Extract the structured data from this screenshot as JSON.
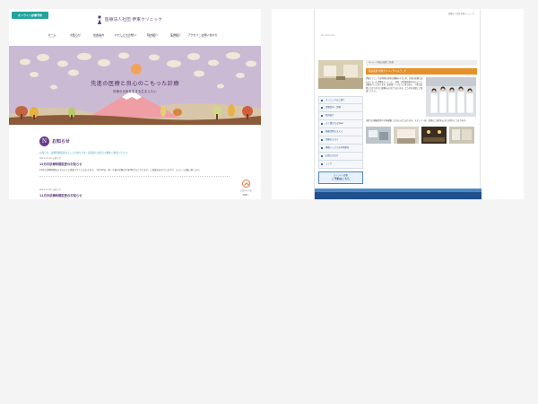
{
  "left": {
    "online_button": "オンライン診療予約",
    "logo_text": "医療法人社団 伊東クリニック",
    "nav": [
      {
        "label": "ホーム",
        "en": "HOME"
      },
      {
        "label": "お知らせ",
        "en": "NEWS"
      },
      {
        "label": "診療案内",
        "en": "MEDICAL"
      },
      {
        "label": "わたしたちの想い",
        "en": "MESSAGE"
      },
      {
        "label": "院内紹介",
        "en": "FACILITY"
      },
      {
        "label": "医師紹介",
        "en": "DOCTOR"
      },
      {
        "label": "アクセス・お問い合わせ",
        "en": "ACCESS"
      }
    ],
    "hero_title": "先進の医療と良心のこもった診療",
    "hero_subtitle": "診療の元気を生きる生まえたい",
    "news_badge": "N",
    "news_title": "お知らせ",
    "news_notice": "お知らせ、診療時間変更なることがあります。来院前にお知らせ欄をご確認ください。",
    "news": [
      {
        "date": "2021.12.22  お知らせ",
        "title": "12月の診療時間変更のお知らせ",
        "body": "12月の診療時間を以下のように変更させていただきます。 12月30日（木）午後の診療は午後3時からとなります。ご迷惑をおかけしますが、よろしくお願い致します。"
      },
      {
        "date": "2021.11.25  お知らせ",
        "title": "11月の診療時間変更のお知らせ",
        "body": ""
      }
    ],
    "totop_line1": "このページの",
    "totop_line2": "TOPへ"
  },
  "right": {
    "top_right": "医療法人社団 伊東クリニック",
    "site_name": "ito-clinic.com",
    "menu": [
      "クリニックのご紹介",
      "診療案内・診療",
      "院内紹介",
      "よく聞かれるQ&A",
      "健康診断のススメ",
      "診療のススメ",
      "睡眠ドックでも早期発見",
      "お問い合わせ",
      "リンク"
    ],
    "banner_line1": "オンライン診療",
    "banner_line2": "ご予約はこちら",
    "breadcrumb": "ホーム > 院長の挨拶 ご挨拶",
    "heading": "院長挨拶 伊東クリニックへようこそ",
    "text": "伊東クリニックは地域の皆様の健康を守るため、先進の医療と良心のこもった診療をモットーに、内科・消化器内科を中心とした診療を行っております。患者様一人ひとりに寄り添い、丁寧な説明とわかりやすい医療を心がけております。どうぞお気軽にご相談ください。",
    "text2": "当院では健康診断や予防接種にも力を入れております。スタッフ一同、皆様のご来院を心よりお待ちしております。"
  },
  "colors": {
    "accent": "#5b3a78",
    "teal": "#23a39b",
    "hero_bg": "#c8b8d2",
    "right_heading": "#e5902b",
    "right_nav": "#1f4f8c"
  }
}
